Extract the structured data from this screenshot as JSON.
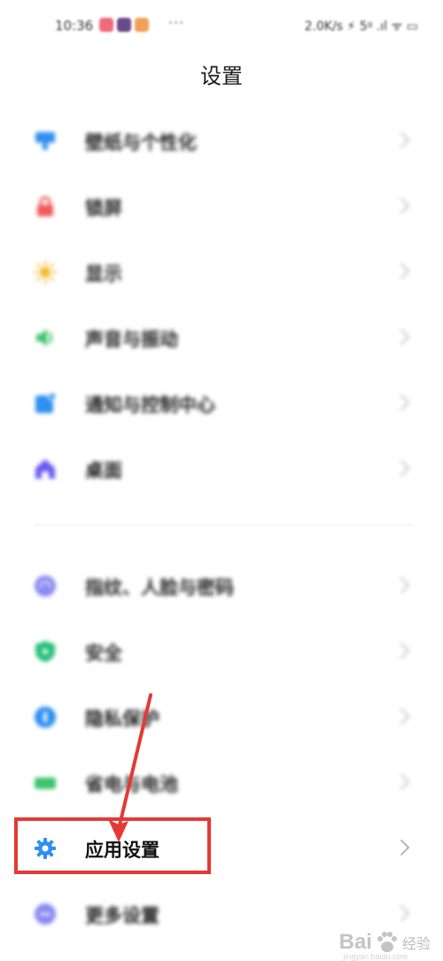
{
  "status_bar": {
    "time": "10:36",
    "more": "···",
    "right": "2.0K/s ⚡ 5ᵍ .ıl ᯤ ▭",
    "app_colors": [
      "#f06a7a",
      "#6a4a8a",
      "#f0a05a"
    ]
  },
  "header": {
    "title": "设置"
  },
  "groups": [
    {
      "items": [
        {
          "label": "壁纸与个性化",
          "icon": "wallpaper-icon",
          "color": "#2f8ff0"
        },
        {
          "label": "锁屏",
          "icon": "lock-icon",
          "color": "#f05a5a"
        },
        {
          "label": "显示",
          "icon": "sun-icon",
          "color": "#f5b82e"
        },
        {
          "label": "声音与振动",
          "icon": "speaker-icon",
          "color": "#3cc46e"
        },
        {
          "label": "通知与控制中心",
          "icon": "notification-icon",
          "color": "#2f8ff0"
        },
        {
          "label": "桌面",
          "icon": "home-icon",
          "color": "#6a5af0"
        }
      ]
    },
    {
      "items": [
        {
          "label": "指纹、人脸与密码",
          "icon": "fingerprint-icon",
          "color": "#8a8af0"
        },
        {
          "label": "安全",
          "icon": "shield-icon",
          "color": "#25c07a"
        },
        {
          "label": "隐私保护",
          "icon": "privacy-icon",
          "color": "#2f8ff0"
        },
        {
          "label": "省电与电池",
          "icon": "battery-icon",
          "color": "#3cc46e"
        },
        {
          "label": "应用设置",
          "icon": "gear-icon",
          "color": "#2f8ff0"
        },
        {
          "label": "更多设置",
          "icon": "more-icon",
          "color": "#8a8af0"
        }
      ]
    }
  ],
  "annotation": {
    "highlight_color": "#e53935"
  },
  "watermark": {
    "brand": "Bai",
    "suffix": "经验",
    "url": "jingyan.baidu.com"
  }
}
